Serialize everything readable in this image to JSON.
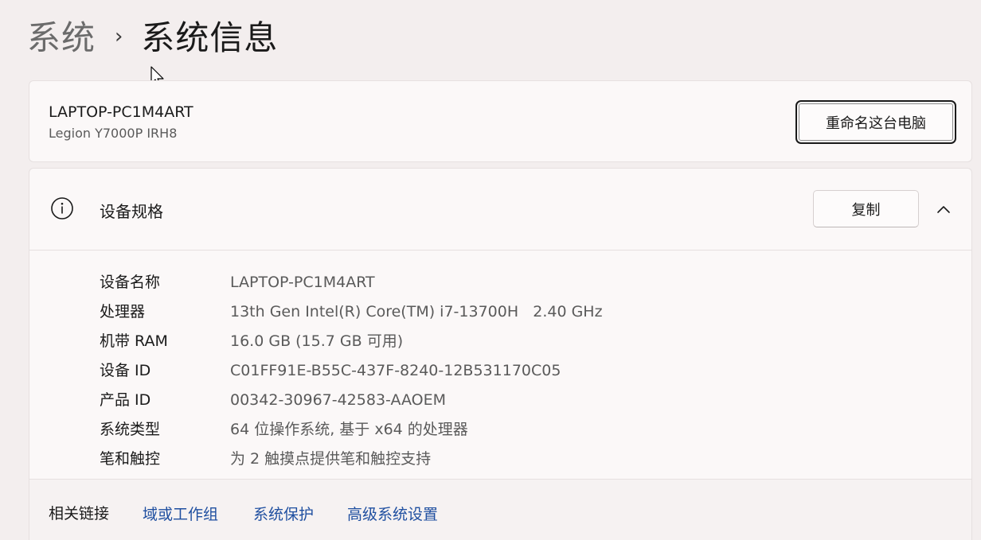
{
  "breadcrumb": {
    "parent": "系统",
    "separator": "›",
    "current": "系统信息"
  },
  "device": {
    "name": "LAPTOP-PC1M4ART",
    "model": "Legion Y7000P IRH8",
    "rename_label": "重命名这台电脑"
  },
  "specs": {
    "title": "设备规格",
    "copy_label": "复制",
    "icons": {
      "info": "info-icon",
      "collapse": "chevron-up-icon"
    },
    "rows": [
      {
        "label": "设备名称",
        "value": "LAPTOP-PC1M4ART"
      },
      {
        "label": "处理器",
        "value": "13th Gen Intel(R) Core(TM) i7-13700H   2.40 GHz"
      },
      {
        "label": "机带 RAM",
        "value": "16.0 GB (15.7 GB 可用)"
      },
      {
        "label": "设备 ID",
        "value": "C01FF91E-B55C-437F-8240-12B531170C05"
      },
      {
        "label": "产品 ID",
        "value": "00342-30967-42583-AAOEM"
      },
      {
        "label": "系统类型",
        "value": "64 位操作系统, 基于 x64 的处理器"
      },
      {
        "label": "笔和触控",
        "value": "为 2 触摸点提供笔和触控支持"
      }
    ]
  },
  "related": {
    "title": "相关链接",
    "links": [
      "域或工作组",
      "系统保护",
      "高级系统设置"
    ]
  },
  "colors": {
    "background": "#f3eeee",
    "card": "#fbf8f8",
    "link": "#1f4fa0",
    "secondary_text": "#5a5a5a"
  }
}
